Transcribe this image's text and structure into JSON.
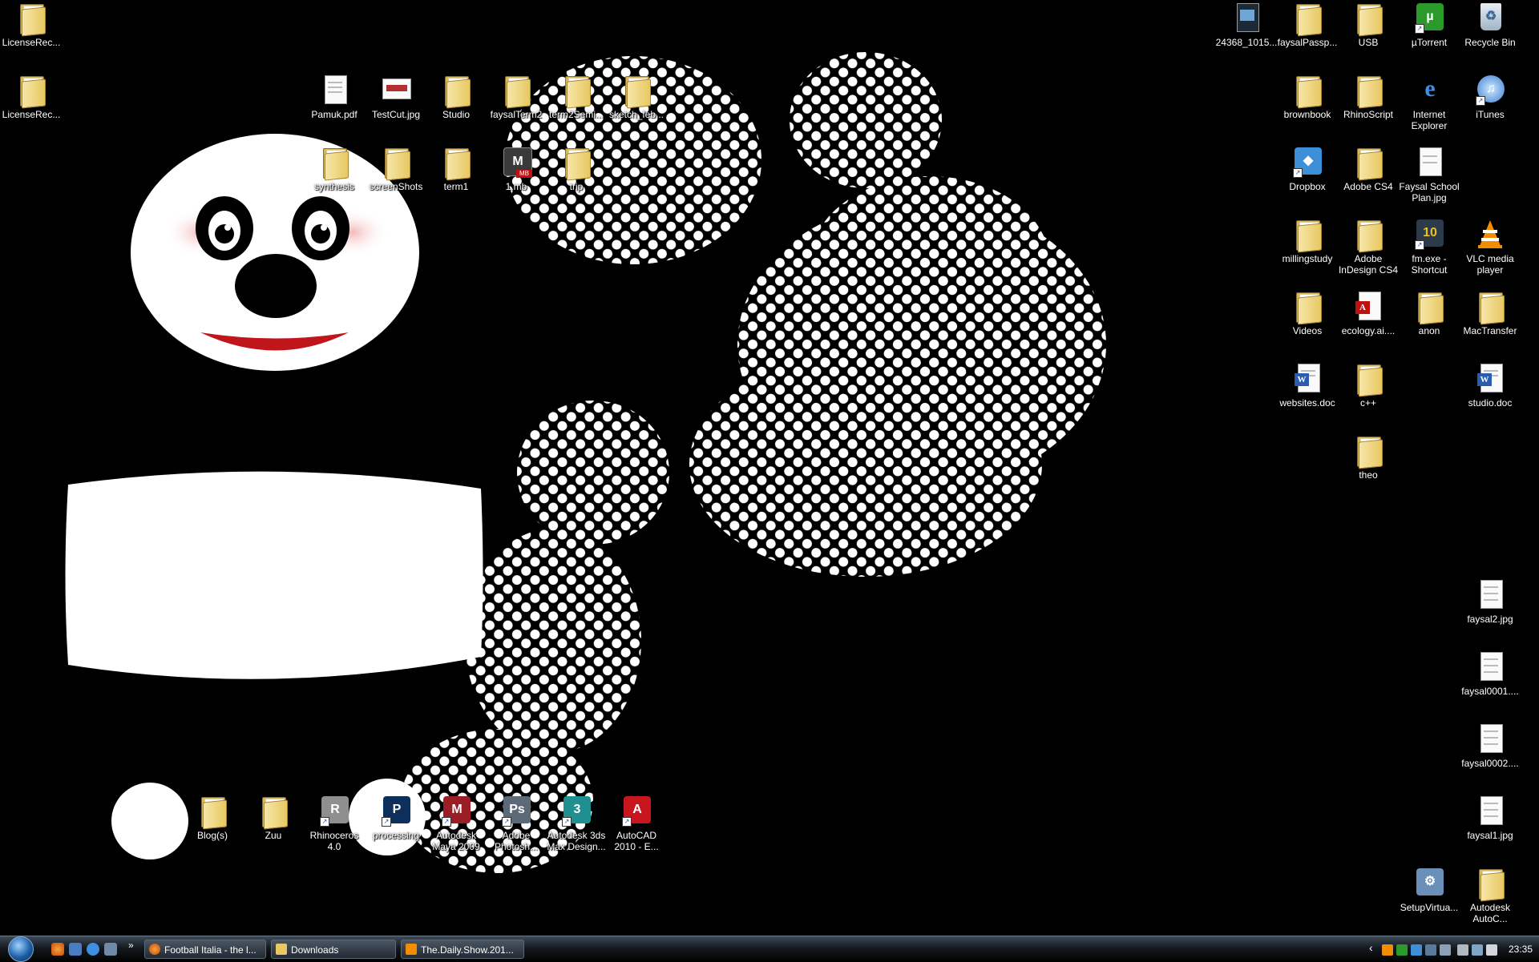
{
  "desktop": {
    "icons": [
      {
        "label": "LicenseRec...",
        "type": "folder"
      },
      {
        "label": "LicenseRec...",
        "type": "folder"
      },
      {
        "label": "Pamuk.pdf",
        "type": "doc"
      },
      {
        "label": "TestCut.jpg",
        "type": "image"
      },
      {
        "label": "Studio",
        "type": "folder"
      },
      {
        "label": "faysalTerm2",
        "type": "folder"
      },
      {
        "label": "term2Semi...",
        "type": "folder"
      },
      {
        "label": "sketch_feb...",
        "type": "folder"
      },
      {
        "label": "synthesis",
        "type": "folder"
      },
      {
        "label": "screenShots",
        "type": "folder"
      },
      {
        "label": "term1",
        "type": "folder"
      },
      {
        "label": "1.mb",
        "type": "maya-file"
      },
      {
        "label": "trip",
        "type": "folder"
      },
      {
        "label": "Blog(s)",
        "type": "folder"
      },
      {
        "label": "Zuu",
        "type": "folder"
      },
      {
        "label": "Rhinoceros 4.0",
        "type": "app"
      },
      {
        "label": "processing",
        "type": "app"
      },
      {
        "label": "Autodesk Maya 2009",
        "type": "app"
      },
      {
        "label": "Adobe Photosh...",
        "type": "app"
      },
      {
        "label": "Autodesk 3ds Max Design...",
        "type": "app"
      },
      {
        "label": "AutoCAD 2010 - E...",
        "type": "app"
      },
      {
        "label": "24368_1015...",
        "type": "image"
      },
      {
        "label": "faysalPassp...",
        "type": "folder"
      },
      {
        "label": "USB",
        "type": "folder"
      },
      {
        "label": "µTorrent",
        "type": "app"
      },
      {
        "label": "Recycle Bin",
        "type": "recycle"
      },
      {
        "label": "brownbook",
        "type": "folder"
      },
      {
        "label": "RhinoScript",
        "type": "folder"
      },
      {
        "label": "Internet Explorer",
        "type": "app"
      },
      {
        "label": "iTunes",
        "type": "app"
      },
      {
        "label": "Dropbox",
        "type": "app"
      },
      {
        "label": "Adobe CS4",
        "type": "folder"
      },
      {
        "label": "Faysal School Plan.jpg",
        "type": "doc"
      },
      {
        "label": "millingstudy",
        "type": "folder"
      },
      {
        "label": "Adobe InDesign CS4",
        "type": "folder"
      },
      {
        "label": "fm.exe - Shortcut",
        "type": "app"
      },
      {
        "label": "VLC media player",
        "type": "app"
      },
      {
        "label": "Videos",
        "type": "folder"
      },
      {
        "label": "ecology.ai....",
        "type": "doc"
      },
      {
        "label": "anon",
        "type": "folder"
      },
      {
        "label": "MacTransfer",
        "type": "folder"
      },
      {
        "label": "websites.doc",
        "type": "doc"
      },
      {
        "label": "c++",
        "type": "folder"
      },
      {
        "label": "studio.doc",
        "type": "doc"
      },
      {
        "label": "theo",
        "type": "folder"
      },
      {
        "label": "faysal2.jpg",
        "type": "doc"
      },
      {
        "label": "faysal0001....",
        "type": "doc"
      },
      {
        "label": "faysal0002....",
        "type": "doc"
      },
      {
        "label": "faysal1.jpg",
        "type": "doc"
      },
      {
        "label": "SetupVirtua...",
        "type": "app"
      },
      {
        "label": "Autodesk AutoC...",
        "type": "folder"
      }
    ]
  },
  "colors": {
    "background": "#000000",
    "folder": "#e7c862",
    "word_blue": "#2a5db0",
    "pdf_red": "#c01010",
    "panda_mouth": "#c0151b"
  },
  "taskbar": {
    "start_label": "Start",
    "quick_launch": [
      "firefox-icon",
      "show-desktop-icon",
      "ie-icon",
      "switch-windows-icon"
    ],
    "more": "»",
    "windows": [
      {
        "label": "Football Italia - the l...",
        "icon": "firefox-icon"
      },
      {
        "label": "Downloads",
        "icon": "downloads-folder-icon"
      },
      {
        "label": "The.Daily.Show.201...",
        "icon": "vlc-icon"
      }
    ],
    "tray_chevron": "‹",
    "clock": "23:35"
  }
}
